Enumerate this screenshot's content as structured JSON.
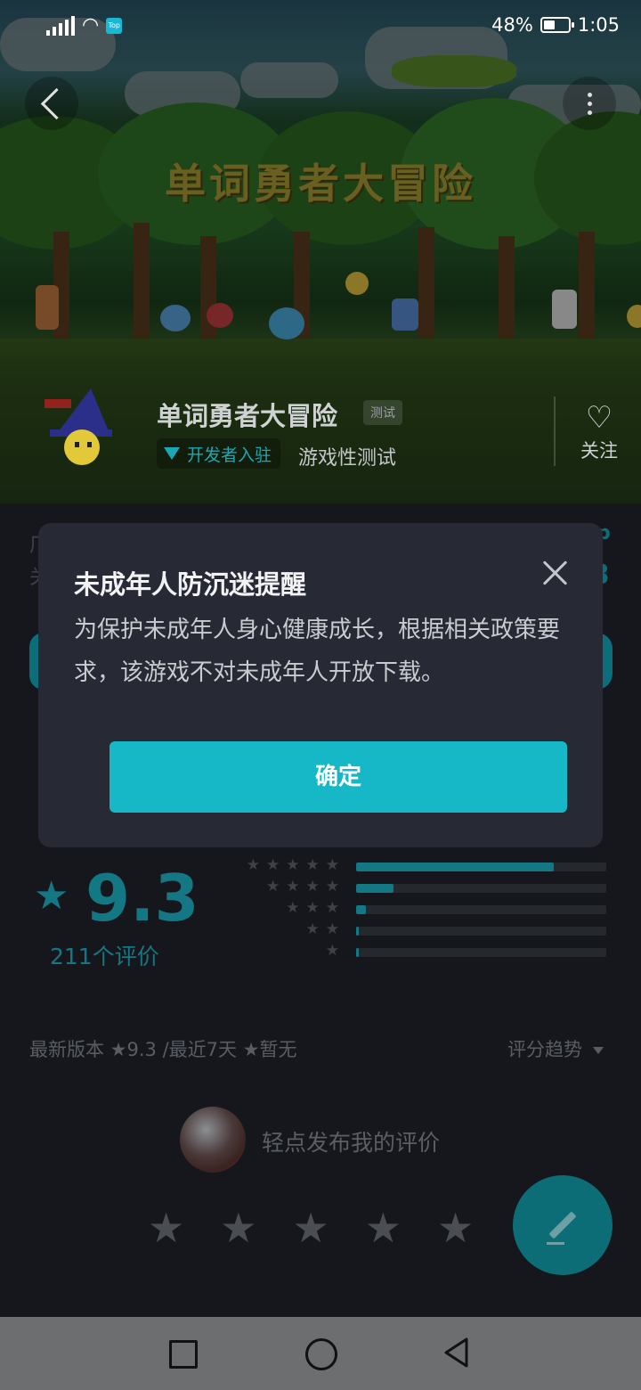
{
  "status_bar": {
    "battery": "48%",
    "battery_level": 0.48,
    "time": "1:05",
    "network_badge": "Top"
  },
  "hero": {
    "banner_title": "单词勇者大冒险"
  },
  "app": {
    "name": "单词勇者大冒险",
    "tag": "测试",
    "developer_badge": "开发者入驻",
    "test_type": "游戏性测试",
    "follow_label": "关注"
  },
  "dialog": {
    "title": "未成年人防沉迷提醒",
    "body": "为保护未成年人身心健康成长，根据相关政策要求，该游戏不对未成年人开放下载。",
    "confirm_label": "确定"
  },
  "rating": {
    "score": "9.3",
    "count": "211个评价",
    "distribution": [
      {
        "stars": 5,
        "fraction": 0.79
      },
      {
        "stars": 4,
        "fraction": 0.15
      },
      {
        "stars": 3,
        "fraction": 0.04
      },
      {
        "stars": 2,
        "fraction": 0.005
      },
      {
        "stars": 1,
        "fraction": 0.005
      }
    ],
    "version_line": "最新版本 ★9.3 /最近7天 ★暂无",
    "trend_label": "评分趋势"
  },
  "review": {
    "post_hint": "轻点发布我的评价"
  },
  "colors": {
    "accent": "#16b8c8",
    "dialog_bg": "#272a35",
    "page_bg": "#15171c"
  }
}
